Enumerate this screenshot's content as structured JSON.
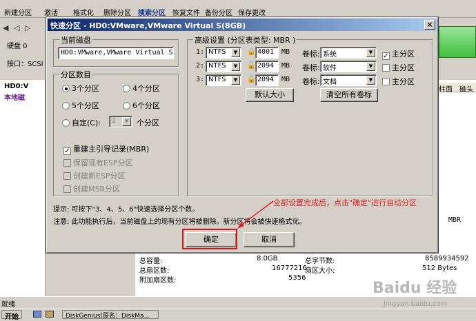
{
  "toolbar": {
    "items": [
      "新建分区",
      "激活",
      "格式化",
      "删除分区",
      "搜索分区",
      "恢复文件",
      "备份分区",
      "保存更改"
    ]
  },
  "left_pane": {
    "nav": "◀ ◁ ▷",
    "disk": "硬盘 0",
    "interface": "接口：SCSI"
  },
  "tree": {
    "item1": "HD0:V",
    "item2": "本地磁"
  },
  "grid_right": {
    "col1": "柱面",
    "col2": "磁头",
    "mbr": "MBR"
  },
  "info_panel": {
    "total_capacity_label": "总容量:",
    "total_capacity_value": "8.0GB",
    "total_sectors_label": "总扇区数:",
    "total_sectors_value": "16777216",
    "extra_sectors_label": "附加扇区数:",
    "extra_sectors_value": "5356",
    "total_bytes_label": "总字节数:",
    "total_bytes_value": "8589934592",
    "sector_size_label": "扇区大小:",
    "sector_size_value": "512 Bytes"
  },
  "status": {
    "text": "就绪"
  },
  "taskbar": {
    "start": "开始",
    "task": "DiskGenius[原名：DiskMa..."
  },
  "dialog": {
    "title": "快速分区 - HD0:VMware,VMware Virtual S(8GB)",
    "current_disk_label": "当前磁盘",
    "current_disk_value": "HD0:VMware,VMware Virtual S",
    "partition_count_label": "分区数目",
    "radios": [
      {
        "label": "3个分区",
        "checked": true
      },
      {
        "label": "4个分区",
        "checked": false
      },
      {
        "label": "5个分区",
        "checked": false
      },
      {
        "label": "6个分区",
        "checked": false
      },
      {
        "label": "自定(C):",
        "checked": false
      }
    ],
    "custom_value": "2",
    "custom_unit": "个分区",
    "rebuild_mbr_label": "重建主引导记录(MBR)",
    "keep_esp_label": "保留现有ESP分区",
    "create_esp_label": "创建新ESP分区",
    "create_msr_label": "创建MSR分区",
    "advanced_label": "高级设置 (分区表类型: MBR )",
    "rows": [
      {
        "num": "1:",
        "fs": "NTFS",
        "size": "4001",
        "unit": "MB",
        "vol_label": "卷标:",
        "volume": "系统",
        "primary": true,
        "primary_label": "主分区"
      },
      {
        "num": "2:",
        "fs": "NTFS",
        "size": "2094",
        "unit": "MB",
        "vol_label": "卷标:",
        "volume": "软件",
        "primary": false,
        "primary_label": "主分区"
      },
      {
        "num": "3:",
        "fs": "NTFS",
        "size": "2094",
        "unit": "MB",
        "vol_label": "卷标:",
        "volume": "文档",
        "primary": false,
        "primary_label": "主分区"
      }
    ],
    "default_size_btn": "默认大小",
    "clear_labels_btn": "清空所有卷标",
    "hint": "提示: 可按下\"3、4、5、6\"快速选择分区个数。",
    "warning": "注意: 此功能执行后，当前磁盘上的现有分区将被删除。新分区将会被快速格式化。",
    "ok_btn": "确定",
    "cancel_btn": "取消"
  },
  "annotation": {
    "text": "全部设置完成后，点击\"确定\"进行自动分区"
  },
  "watermark": {
    "main": "Baidu 经验",
    "sub": "jingyan.baidu.com"
  },
  "colors": {
    "title_start": "#0a246a",
    "title_end": "#a6caf0",
    "annotation": "#e02020",
    "highlight_box": "#d01818"
  }
}
